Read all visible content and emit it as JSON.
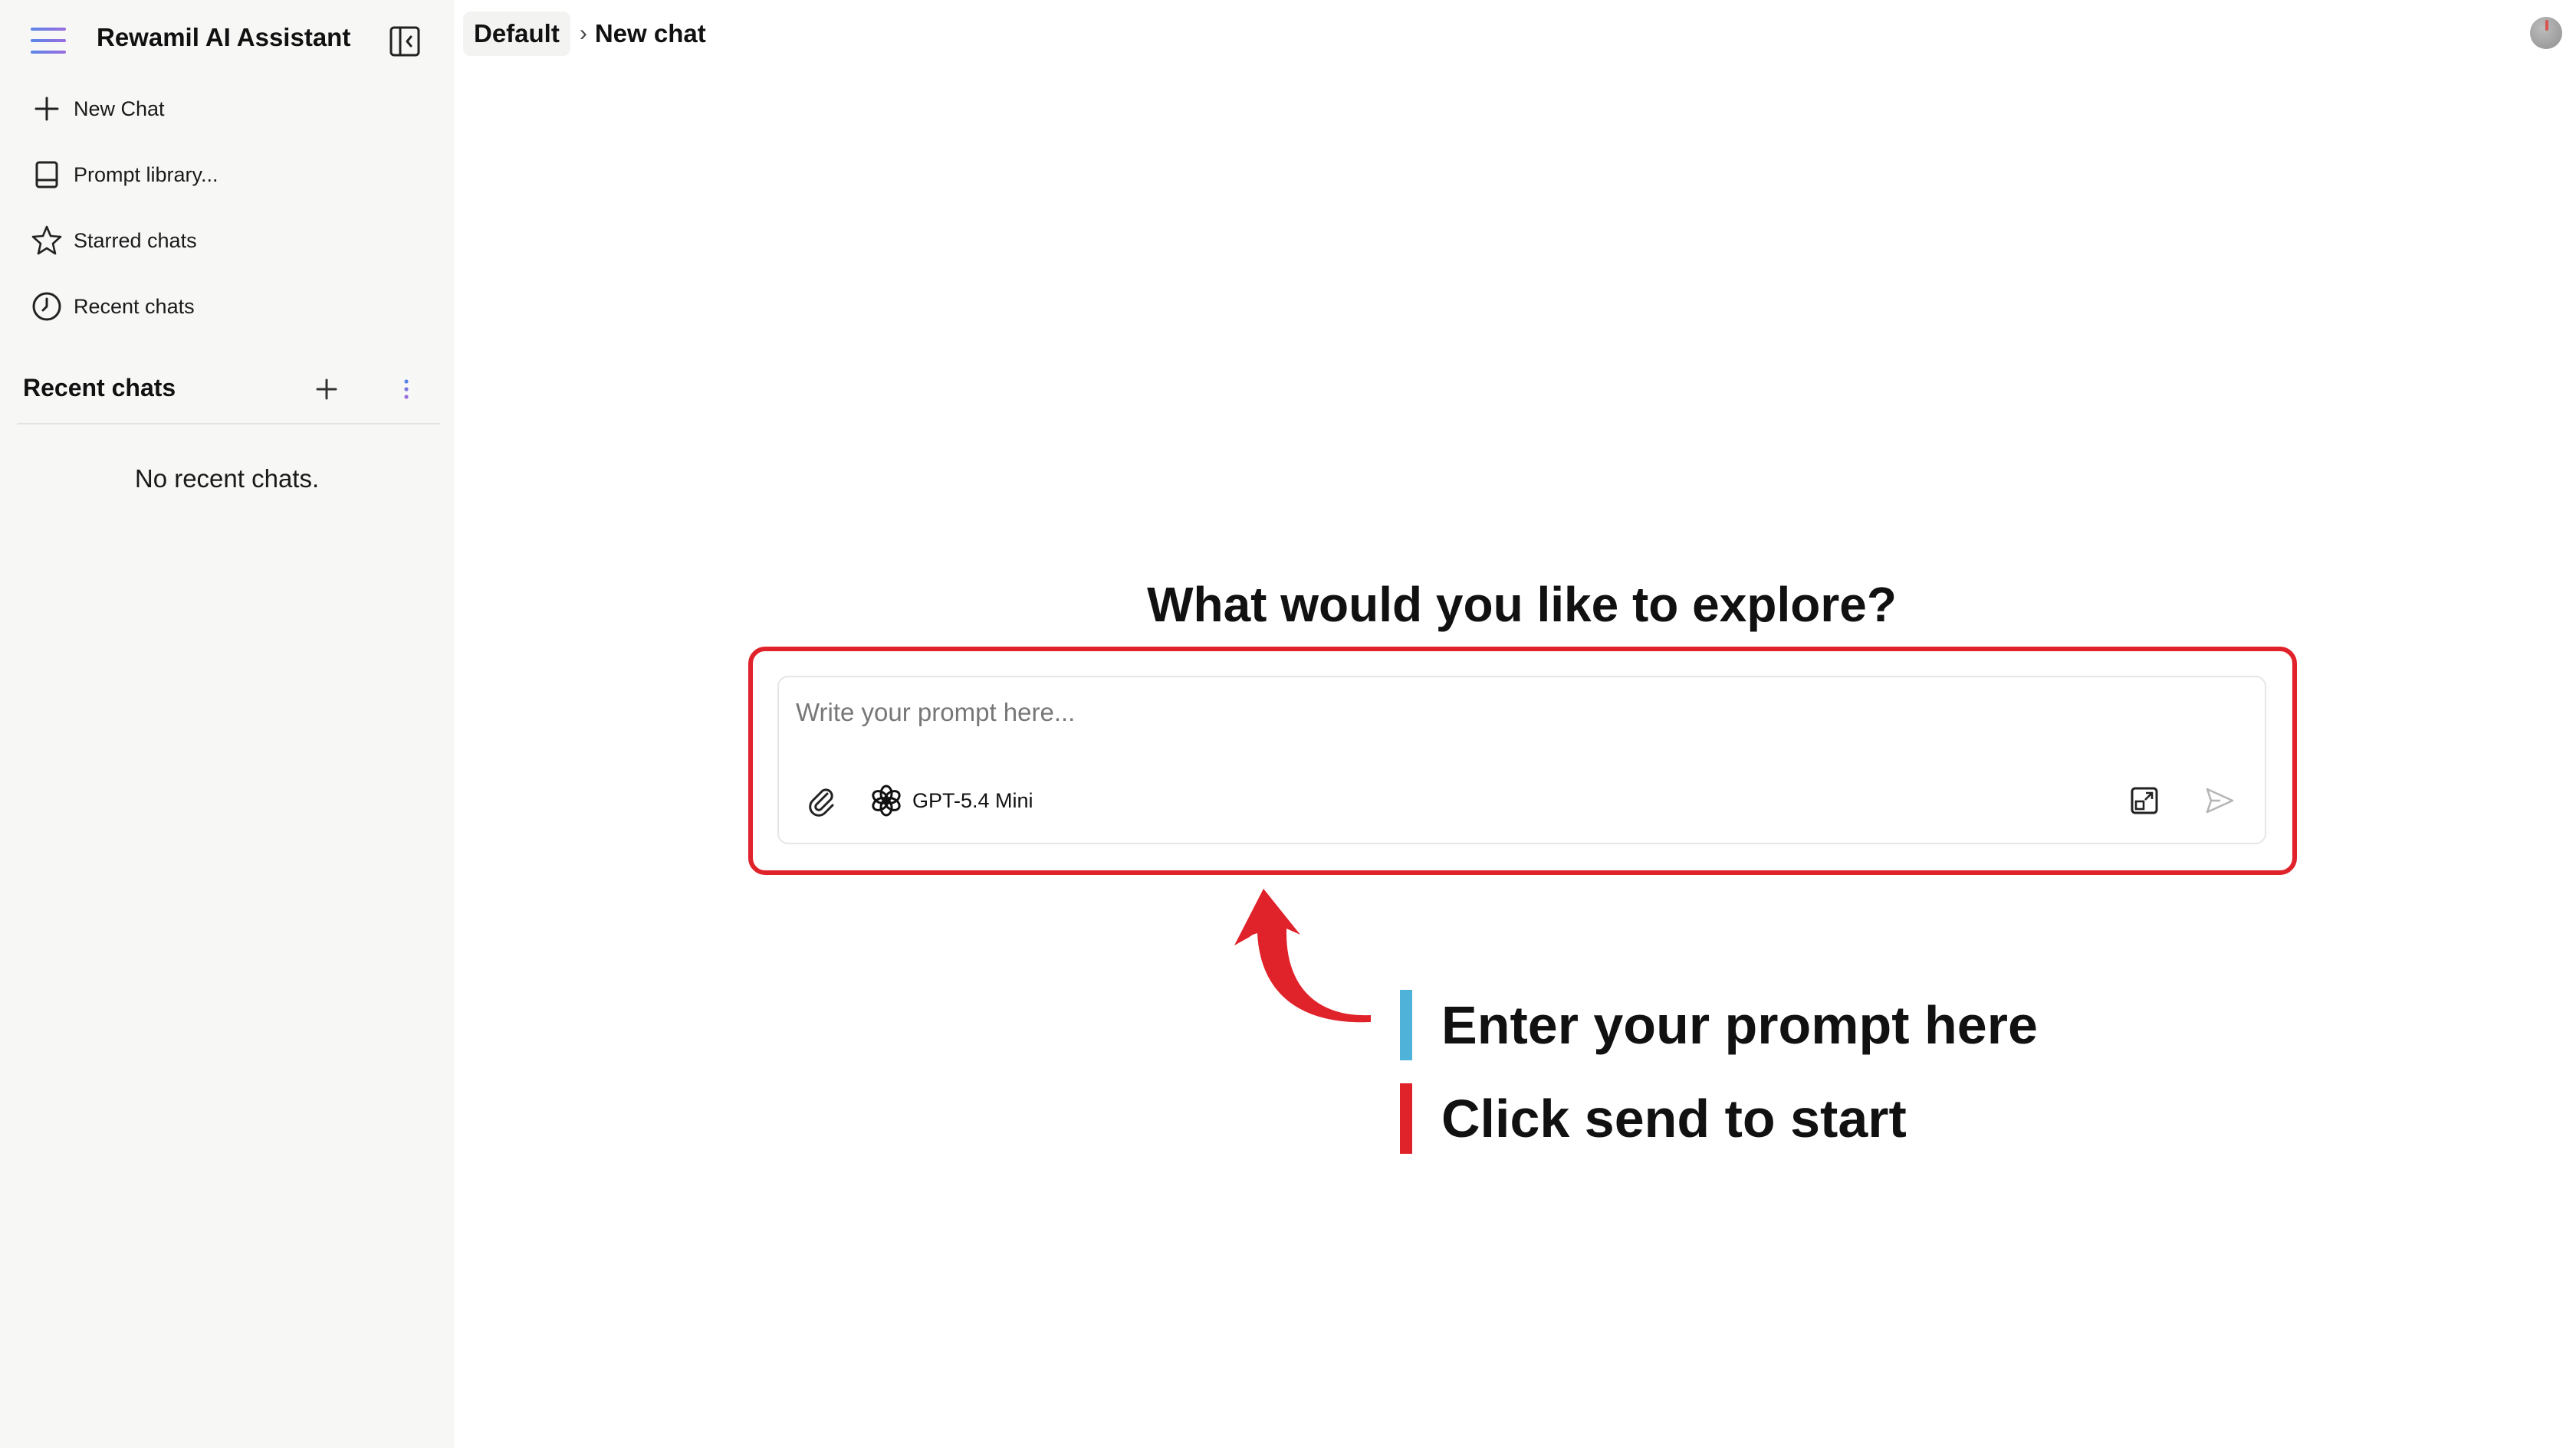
{
  "app": {
    "title": "Rewamil AI Assistant"
  },
  "sidebar": {
    "nav": [
      {
        "label": "New Chat",
        "icon": "plus-icon"
      },
      {
        "label": "Prompt library...",
        "icon": "book-icon"
      },
      {
        "label": "Starred chats",
        "icon": "star-icon"
      },
      {
        "label": "Recent chats",
        "icon": "clock-icon"
      }
    ],
    "recent_section": {
      "title": "Recent chats",
      "empty_text": "No recent chats."
    }
  },
  "breadcrumb": {
    "root": "Default",
    "separator": "›",
    "current": "New chat"
  },
  "main": {
    "headline": "What would you like to explore?",
    "composer": {
      "placeholder": "Write your prompt here...",
      "value": "",
      "model": "GPT-5.4 Mini"
    }
  },
  "annotation": {
    "hints": [
      {
        "text": "Enter your prompt here",
        "color": "#4fb3d9"
      },
      {
        "text": "Click send to start",
        "color": "#e0222a"
      }
    ],
    "arrow_color": "#e0222a"
  },
  "colors": {
    "sidebar_bg": "#f7f7f6",
    "highlight": "#e0222a",
    "accent_gradient": [
      "#5a86e8",
      "#9a6ddf"
    ]
  }
}
